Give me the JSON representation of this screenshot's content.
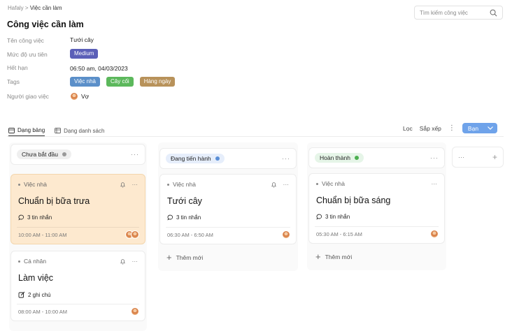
{
  "breadcrumb": {
    "root": "Hafaly",
    "sep": ">",
    "current": "Việc cần làm"
  },
  "search": {
    "placeholder": "Tìm kiếm công việc"
  },
  "page_title": "Công việc cần làm",
  "details": {
    "name_label": "Tên công việc",
    "name_value": "Tưới cây",
    "priority_label": "Mức độ ưu tiên",
    "priority_value": "Medium",
    "deadline_label": "Hết hạn",
    "deadline_value": "06:50 am, 04/03/2023",
    "tags_label": "Tags",
    "tags": [
      "Việc nhà",
      "Cây cối",
      "Hàng ngày"
    ],
    "assigner_label": "Người giao việc",
    "assigner_value": "Vợ"
  },
  "views": {
    "board": "Dạng bảng",
    "list": "Dạng danh sách"
  },
  "toolbar": {
    "filter": "Lọc",
    "sort": "Sắp xếp",
    "more": "⋮",
    "ban": "Bạn"
  },
  "columns": [
    {
      "status": "Chưa bắt đầu",
      "cards": [
        {
          "category": "Việc nhà",
          "title": "Chuẩn bị bữa trưa",
          "meta": "3 tin nhắn",
          "time": "10:00 AM - 11:00 AM"
        },
        {
          "category": "Cá nhân",
          "title": "Làm việc",
          "meta": "2 ghi chú",
          "time": "08:00 AM - 10:00 AM"
        }
      ]
    },
    {
      "status": "Đang tiến hành",
      "cards": [
        {
          "category": "Việc nhà",
          "title": "Tưới cây",
          "meta": "3 tin nhắn",
          "time": "06:30 AM - 6:50 AM"
        }
      ],
      "add_label": "Thêm mới"
    },
    {
      "status": "Hoàn thành",
      "cards": [
        {
          "category": "Việc nhà",
          "title": "Chuẩn bị bữa sáng",
          "meta": "3 tin nhắn",
          "time": "05:30 AM - 6:15 AM"
        }
      ],
      "add_label": "Thêm mới"
    }
  ],
  "menu_dots": "···",
  "colors": {
    "priority": "#5b5fb8",
    "tag_home": "#5b8fc9",
    "tag_plant": "#5cb85c",
    "tag_daily": "#b8925a",
    "accent": "#6fa3ea"
  },
  "icons": [
    "search-icon",
    "board-view-icon",
    "list-view-icon",
    "chevron-down-icon",
    "bell-icon",
    "chat-icon",
    "edit-icon",
    "plus-icon"
  ]
}
